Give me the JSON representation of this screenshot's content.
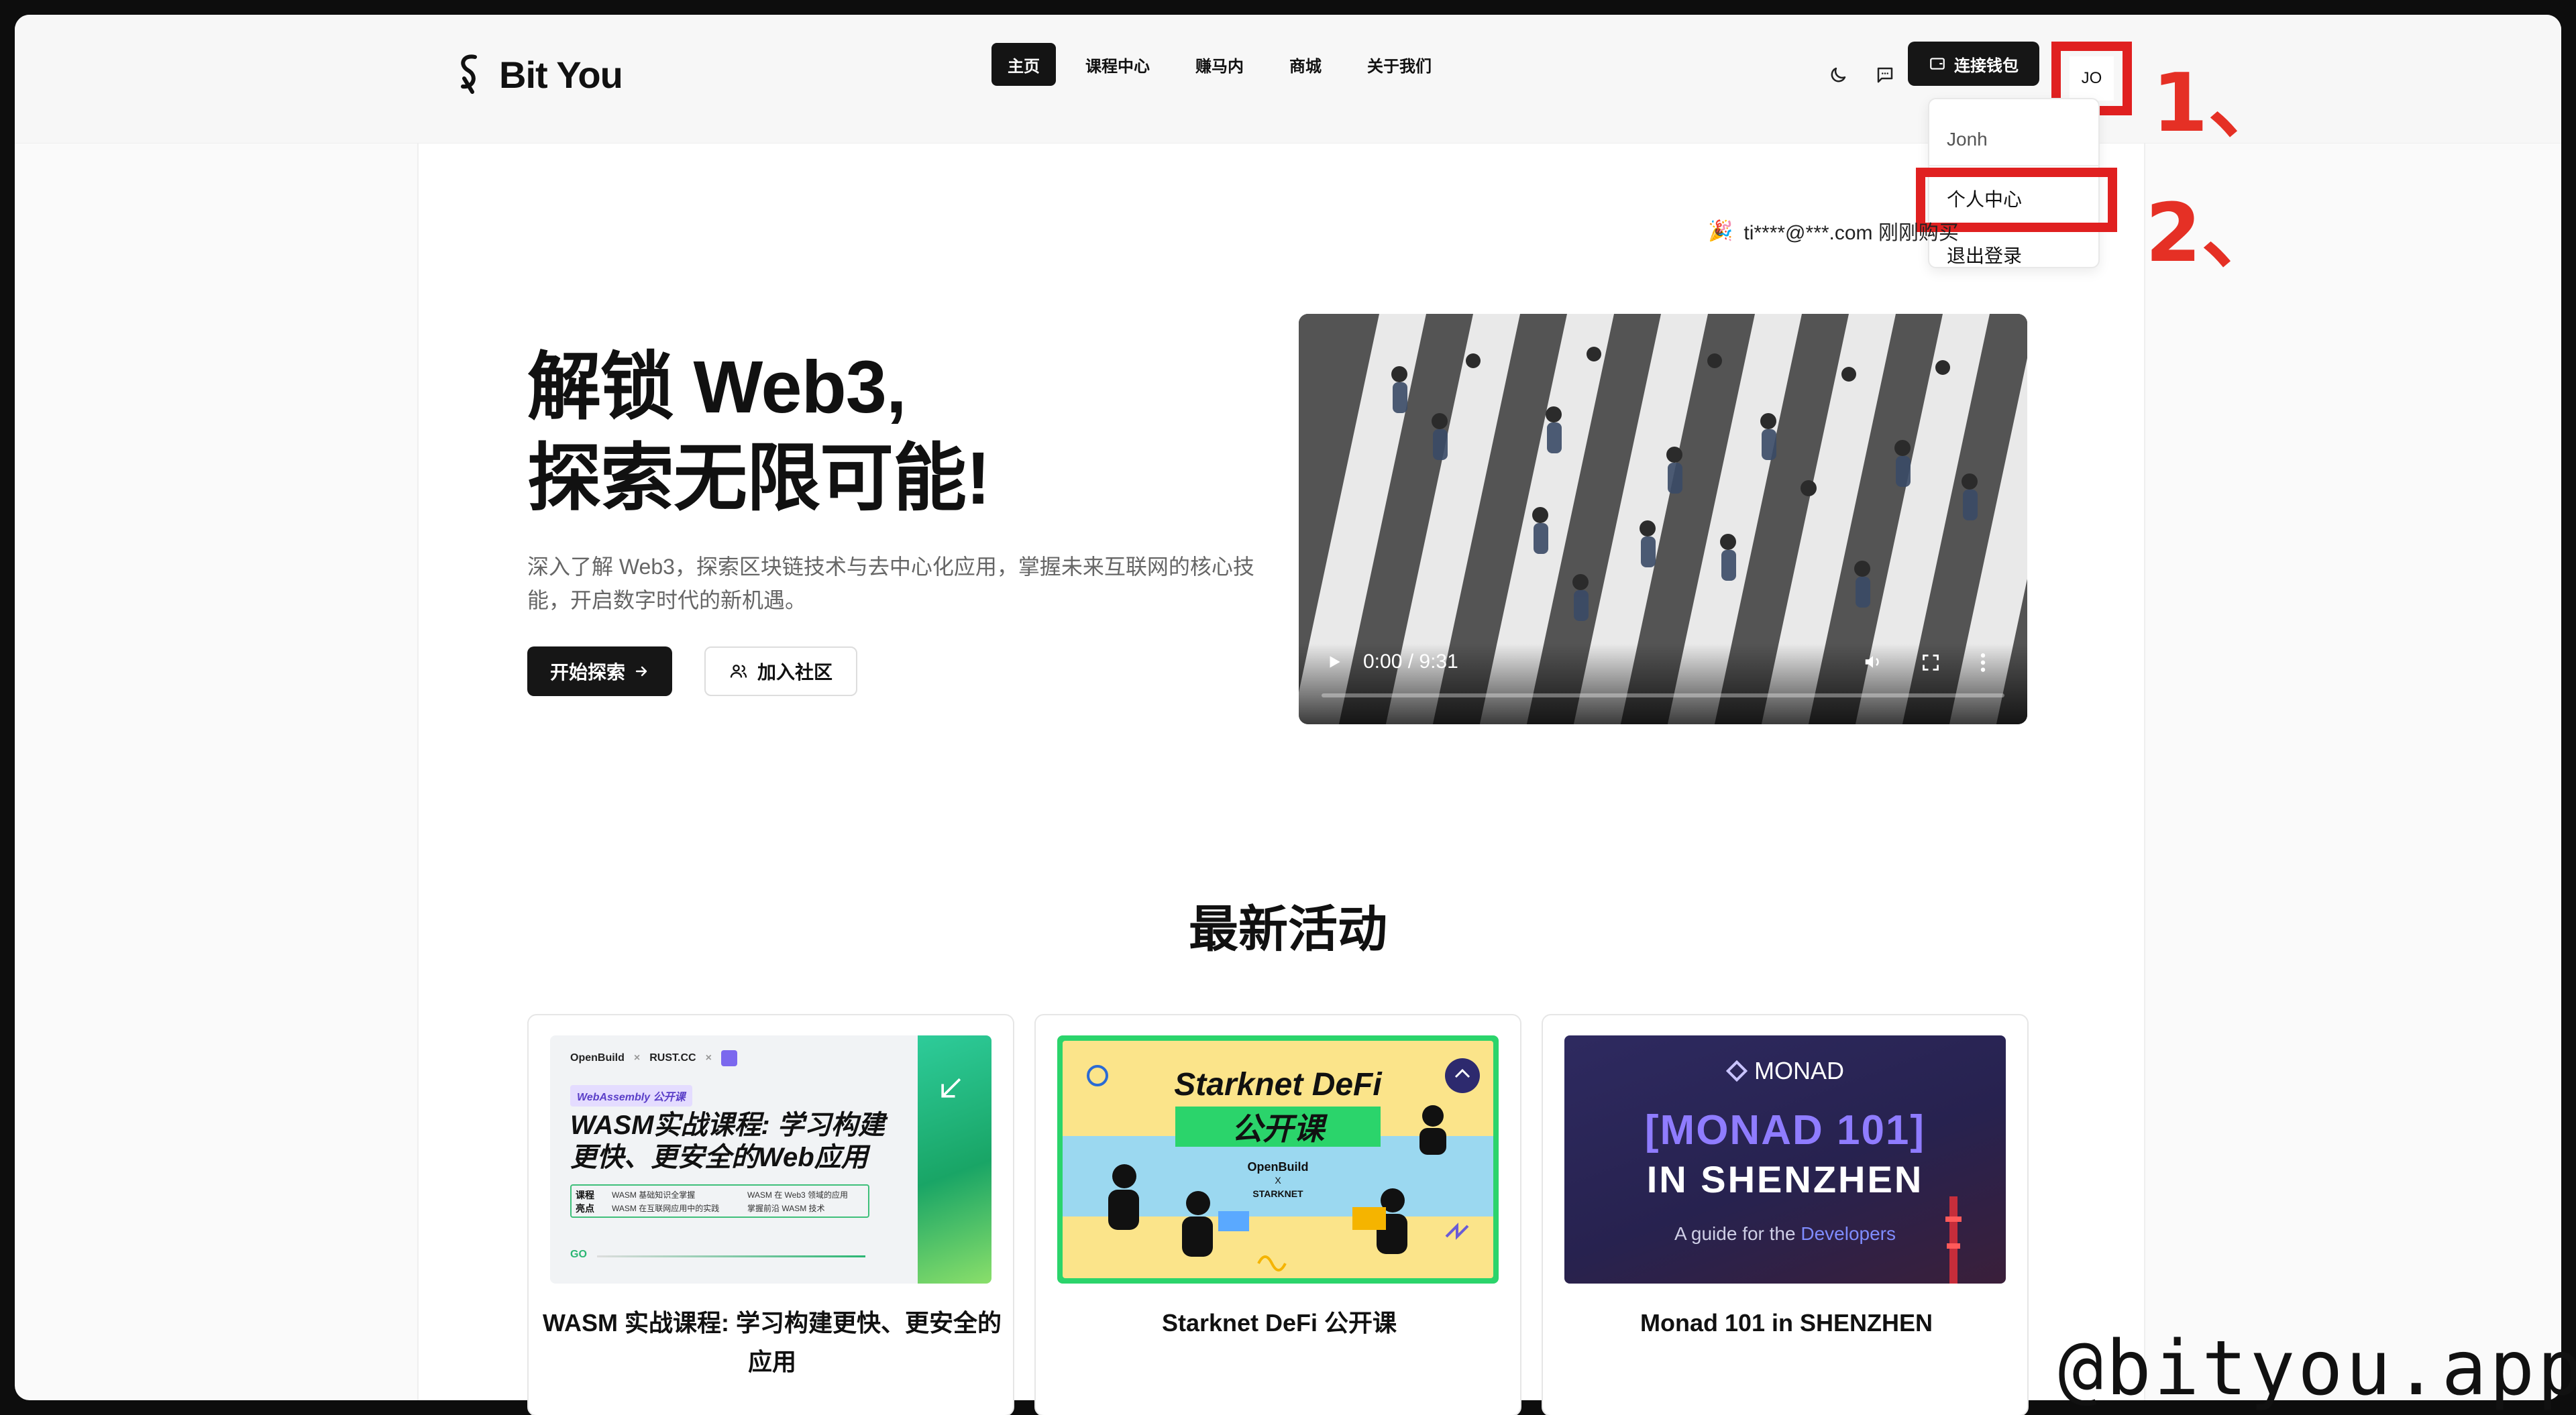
{
  "brand": {
    "name": "Bit You"
  },
  "nav": [
    {
      "label": "主页",
      "active": true
    },
    {
      "label": "课程中心",
      "active": false
    },
    {
      "label": "赚马内",
      "active": false
    },
    {
      "label": "商城",
      "active": false
    },
    {
      "label": "关于我们",
      "active": false
    }
  ],
  "header": {
    "wallet_label": "连接钱包",
    "avatar_initials": "JO",
    "icons": [
      "moon-icon",
      "chat-icon"
    ]
  },
  "user_menu": {
    "username": "Jonh",
    "items": [
      "个人中心",
      "退出登录"
    ]
  },
  "annotations": {
    "step1": "1、",
    "step2": "2、"
  },
  "ticker": {
    "text": "ti****@***.com 刚刚购买"
  },
  "hero": {
    "title_line1": "解锁 Web3,",
    "title_line2": "探索无限可能!",
    "description": "深入了解 Web3，探索区块链技术与去中心化应用，掌握未来互联网的核心技能，开启数字时代的新机遇。",
    "primary_button": "开始探索",
    "secondary_button": "加入社区"
  },
  "video": {
    "time": "0:00 / 9:31"
  },
  "activities": {
    "title": "最新活动",
    "cards": [
      {
        "title": "WASM 实战课程: 学习构建更快、更安全的应用",
        "image": {
          "org1": "OpenBuild",
          "org2": "RUST.CC",
          "tag": "WebAssembly 公开课",
          "headline1": "WASM实战课程: 学习构建",
          "headline2": "更快、更安全的Web应用",
          "box_label": "课程亮点",
          "bullets": [
            "WASM 基础知识全掌握",
            "WASM 在互联网应用中的实践",
            "WASM 在 Web3 领域的应用",
            "掌握前沿 WASM 技术"
          ],
          "go": "GO"
        }
      },
      {
        "title": "Starknet DeFi 公开课",
        "image": {
          "line1": "Starknet DeFi",
          "line2": "公开课",
          "org": "OpenBuild",
          "x": "X",
          "partner": "STARKNET"
        }
      },
      {
        "title": "Monad 101 in SHENZHEN",
        "image": {
          "brand": "MONAD",
          "line1": "[MONAD 101]",
          "line2": "IN SHENZHEN",
          "tagline_prefix": "A guide for the ",
          "tagline_highlight": "Developers"
        }
      }
    ]
  },
  "watermark": "@bityou.app",
  "colors": {
    "accent": "#161616",
    "annotation": "#e02020",
    "monad_purple": "#2a2655",
    "starknet_green": "#2bd46b"
  }
}
